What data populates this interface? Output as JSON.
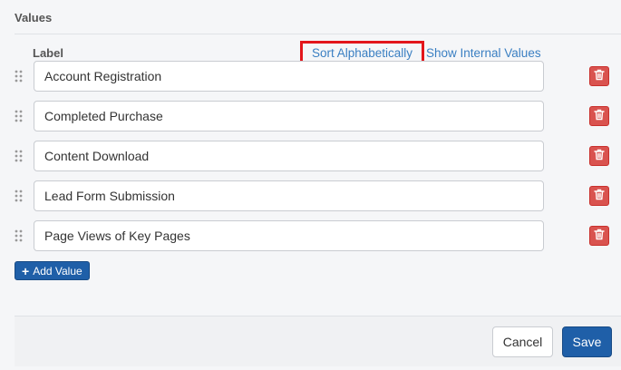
{
  "section": {
    "title": "Values"
  },
  "table": {
    "label_header": "Label",
    "sort_link": "Sort Alphabetically",
    "internal_link": "Show Internal Values"
  },
  "values": [
    {
      "label": "Account Registration"
    },
    {
      "label": "Completed Purchase"
    },
    {
      "label": "Content Download"
    },
    {
      "label": "Lead Form Submission"
    },
    {
      "label": "Page Views of Key Pages"
    }
  ],
  "add_button": {
    "label": "Add Value"
  },
  "footer": {
    "cancel_label": "Cancel",
    "save_label": "Save"
  },
  "colors": {
    "primary": "#1f5fa8",
    "danger": "#d9534f",
    "link": "#3a7fc2",
    "highlight": "#e3161b"
  },
  "icons": {
    "drag": "drag-handle-icon",
    "delete": "trash-icon",
    "add": "plus-icon"
  }
}
